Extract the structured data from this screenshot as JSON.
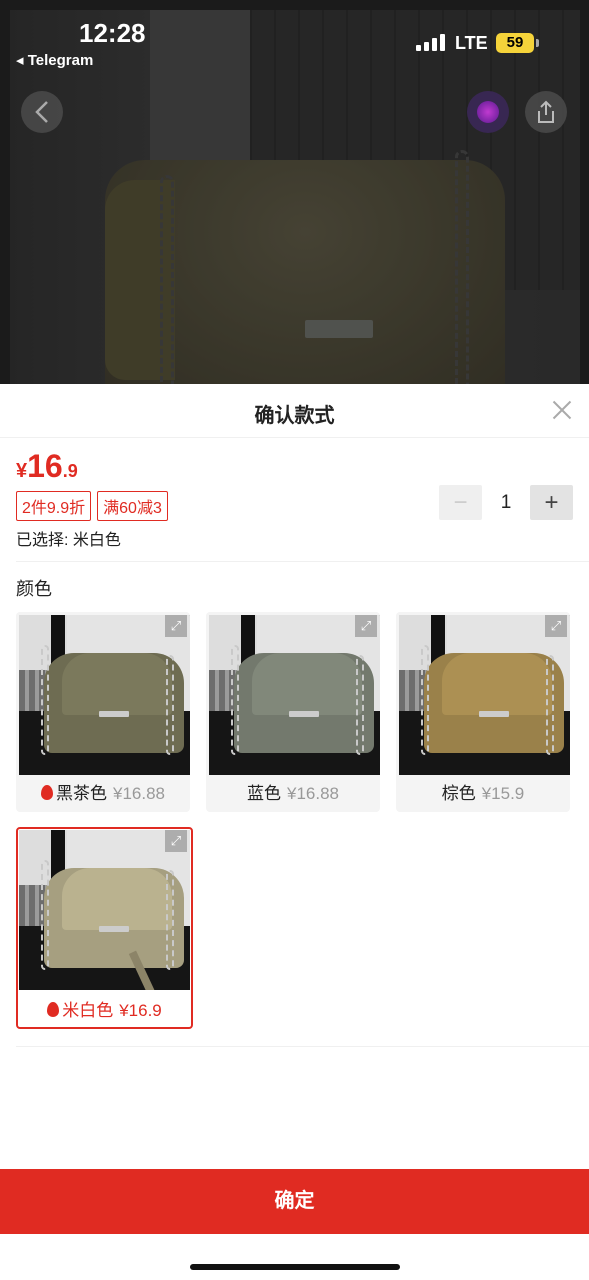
{
  "status": {
    "time": "12:28",
    "back_app": "◂ Telegram",
    "network": "LTE",
    "battery": "59"
  },
  "hero": {
    "back_icon": "chevron-left-icon",
    "share_icon": "share-icon"
  },
  "sheet": {
    "title": "确认款式",
    "price": {
      "currency": "¥",
      "integer": "16",
      "decimal": ".9"
    },
    "promos": [
      "2件9.9折",
      "满60减3"
    ],
    "quantity": {
      "minus": "−",
      "value": "1",
      "plus": "+"
    },
    "selected_text": "已选择: 米白色",
    "color_section_label": "颜色",
    "variants": [
      {
        "name": "黑茶色",
        "price": "¥16.88",
        "hot": true,
        "selected": false,
        "color": "#7c7a5e"
      },
      {
        "name": "蓝色",
        "price": "¥16.88",
        "hot": false,
        "selected": false,
        "color": "#7d8478"
      },
      {
        "name": "棕色",
        "price": "¥15.9",
        "hot": false,
        "selected": false,
        "color": "#a08a52"
      },
      {
        "name": "米白色",
        "price": "¥16.9",
        "hot": true,
        "selected": true,
        "color": "#b5ad8c"
      }
    ],
    "confirm_label": "确定"
  },
  "colors": {
    "accent": "#e02b22"
  }
}
